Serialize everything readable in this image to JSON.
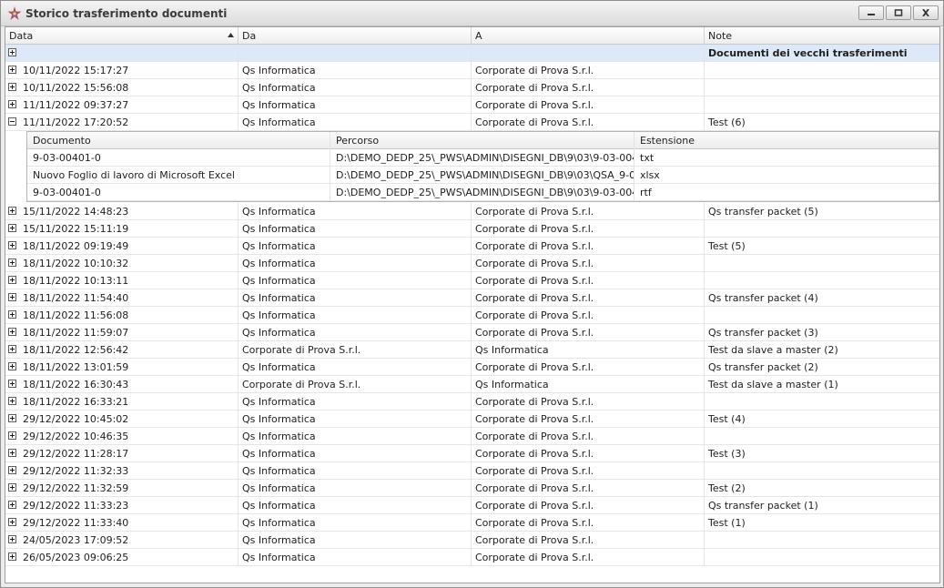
{
  "window": {
    "title": "Storico trasferimento documenti"
  },
  "columns": {
    "data": "Data",
    "da": "Da",
    "a": "A",
    "note": "Note"
  },
  "group_row": {
    "note": "Documenti dei vecchi trasferimenti"
  },
  "detail": {
    "columns": {
      "documento": "Documento",
      "percorso": "Percorso",
      "estensione": "Estensione"
    },
    "rows": [
      {
        "documento": "9-03-00401-0",
        "percorso": "D:\\DEMO_DEDP_25\\_PWS\\ADMIN\\DISEGNI_DB\\9\\03\\9-03-004...",
        "estensione": "txt"
      },
      {
        "documento": "Nuovo Foglio di lavoro di Microsoft Excel",
        "percorso": "D:\\DEMO_DEDP_25\\_PWS\\ADMIN\\DISEGNI_DB\\9\\03\\QSA_9-0...",
        "estensione": "xlsx"
      },
      {
        "documento": "9-03-00401-0",
        "percorso": "D:\\DEMO_DEDP_25\\_PWS\\ADMIN\\DISEGNI_DB\\9\\03\\9-03-004...",
        "estensione": "rtf"
      }
    ]
  },
  "rows": [
    {
      "data": "10/11/2022 15:17:27",
      "da": "Qs Informatica",
      "a": "Corporate di Prova S.r.l.",
      "note": ""
    },
    {
      "data": "10/11/2022 15:56:08",
      "da": "Qs Informatica",
      "a": "Corporate di Prova S.r.l.",
      "note": ""
    },
    {
      "data": "11/11/2022 09:37:27",
      "da": "Qs Informatica",
      "a": "Corporate di Prova S.r.l.",
      "note": ""
    },
    {
      "data": "11/11/2022 17:20:52",
      "da": "Qs Informatica",
      "a": "Corporate di Prova S.r.l.",
      "note": "Test (6)"
    },
    {
      "data": "15/11/2022 14:48:23",
      "da": "Qs Informatica",
      "a": "Corporate di Prova S.r.l.",
      "note": "Qs transfer packet (5)"
    },
    {
      "data": "15/11/2022 15:11:19",
      "da": "Qs Informatica",
      "a": "Corporate di Prova S.r.l.",
      "note": ""
    },
    {
      "data": "18/11/2022 09:19:49",
      "da": "Qs Informatica",
      "a": "Corporate di Prova S.r.l.",
      "note": "Test (5)"
    },
    {
      "data": "18/11/2022 10:10:32",
      "da": "Qs Informatica",
      "a": "Corporate di Prova S.r.l.",
      "note": ""
    },
    {
      "data": "18/11/2022 10:13:11",
      "da": "Qs Informatica",
      "a": "Corporate di Prova S.r.l.",
      "note": ""
    },
    {
      "data": "18/11/2022 11:54:40",
      "da": "Qs Informatica",
      "a": "Corporate di Prova S.r.l.",
      "note": "Qs transfer packet (4)"
    },
    {
      "data": "18/11/2022 11:56:08",
      "da": "Qs Informatica",
      "a": "Corporate di Prova S.r.l.",
      "note": ""
    },
    {
      "data": "18/11/2022 11:59:07",
      "da": "Qs Informatica",
      "a": "Corporate di Prova S.r.l.",
      "note": "Qs transfer packet (3)"
    },
    {
      "data": "18/11/2022 12:56:42",
      "da": "Corporate di Prova S.r.l.",
      "a": "Qs Informatica",
      "note": "Test da slave a master (2)"
    },
    {
      "data": "18/11/2022 13:01:59",
      "da": "Qs Informatica",
      "a": "Corporate di Prova S.r.l.",
      "note": "Qs transfer packet (2)"
    },
    {
      "data": "18/11/2022 16:30:43",
      "da": "Corporate di Prova S.r.l.",
      "a": "Qs Informatica",
      "note": "Test da slave a master (1)"
    },
    {
      "data": "18/11/2022 16:33:21",
      "da": "Qs Informatica",
      "a": "Corporate di Prova S.r.l.",
      "note": ""
    },
    {
      "data": "29/12/2022 10:45:02",
      "da": "Qs Informatica",
      "a": "Corporate di Prova S.r.l.",
      "note": "Test (4)"
    },
    {
      "data": "29/12/2022 10:46:35",
      "da": "Qs Informatica",
      "a": "Corporate di Prova S.r.l.",
      "note": ""
    },
    {
      "data": "29/12/2022 11:28:17",
      "da": "Qs Informatica",
      "a": "Corporate di Prova S.r.l.",
      "note": "Test (3)"
    },
    {
      "data": "29/12/2022 11:32:33",
      "da": "Qs Informatica",
      "a": "Corporate di Prova S.r.l.",
      "note": ""
    },
    {
      "data": "29/12/2022 11:32:59",
      "da": "Qs Informatica",
      "a": "Corporate di Prova S.r.l.",
      "note": "Test (2)"
    },
    {
      "data": "29/12/2022 11:33:23",
      "da": "Qs Informatica",
      "a": "Corporate di Prova S.r.l.",
      "note": "Qs transfer packet (1)"
    },
    {
      "data": "29/12/2022 11:33:40",
      "da": "Qs Informatica",
      "a": "Corporate di Prova S.r.l.",
      "note": "Test (1)"
    },
    {
      "data": "24/05/2023 17:09:52",
      "da": "Qs Informatica",
      "a": "Corporate di Prova S.r.l.",
      "note": ""
    },
    {
      "data": "26/05/2023 09:06:25",
      "da": "Qs Informatica",
      "a": "Corporate di Prova S.r.l.",
      "note": ""
    }
  ],
  "expanded_row_index": 3,
  "colors": {
    "group_row_bg": "#dde8f8",
    "grid_bg": "#ffffff",
    "title_bg": "#e4e4e4"
  },
  "icons": {
    "app": "star-logo-icon",
    "minimize": "minimize-icon",
    "maximize": "maximize-icon",
    "close": "close-icon",
    "sort": "sort-ascending-icon",
    "expand": "expand-plus-icon",
    "collapse": "collapse-minus-icon"
  }
}
